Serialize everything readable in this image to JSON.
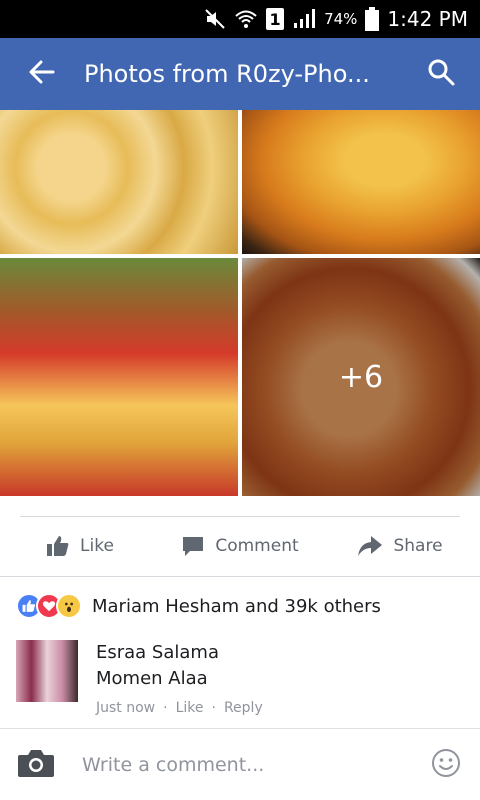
{
  "status_bar": {
    "sim": "1",
    "battery_percent": "74%",
    "time": "1:42 PM"
  },
  "app_bar": {
    "title": "Photos from R0zy-Pho...",
    "back_icon": "arrow-left-icon",
    "search_icon": "search-icon",
    "background_color": "#4267b2"
  },
  "photos": {
    "items": [
      {
        "name": "macaroni-and-cheese"
      },
      {
        "name": "pizza"
      },
      {
        "name": "burgers-and-fries"
      },
      {
        "name": "fried-chicken"
      }
    ],
    "more_count": "+6"
  },
  "actions": {
    "like": "Like",
    "comment": "Comment",
    "share": "Share"
  },
  "reactions": {
    "icons": [
      "like-reaction-icon",
      "love-reaction-icon",
      "wow-reaction-icon"
    ],
    "text": "Mariam Hesham and 39k others"
  },
  "comment": {
    "names": [
      "Esraa Salama",
      "Momen Alaa"
    ],
    "time": "Just now",
    "separator": "·",
    "like": "Like",
    "reply": "Reply"
  },
  "composer": {
    "placeholder": "Write a comment..."
  }
}
